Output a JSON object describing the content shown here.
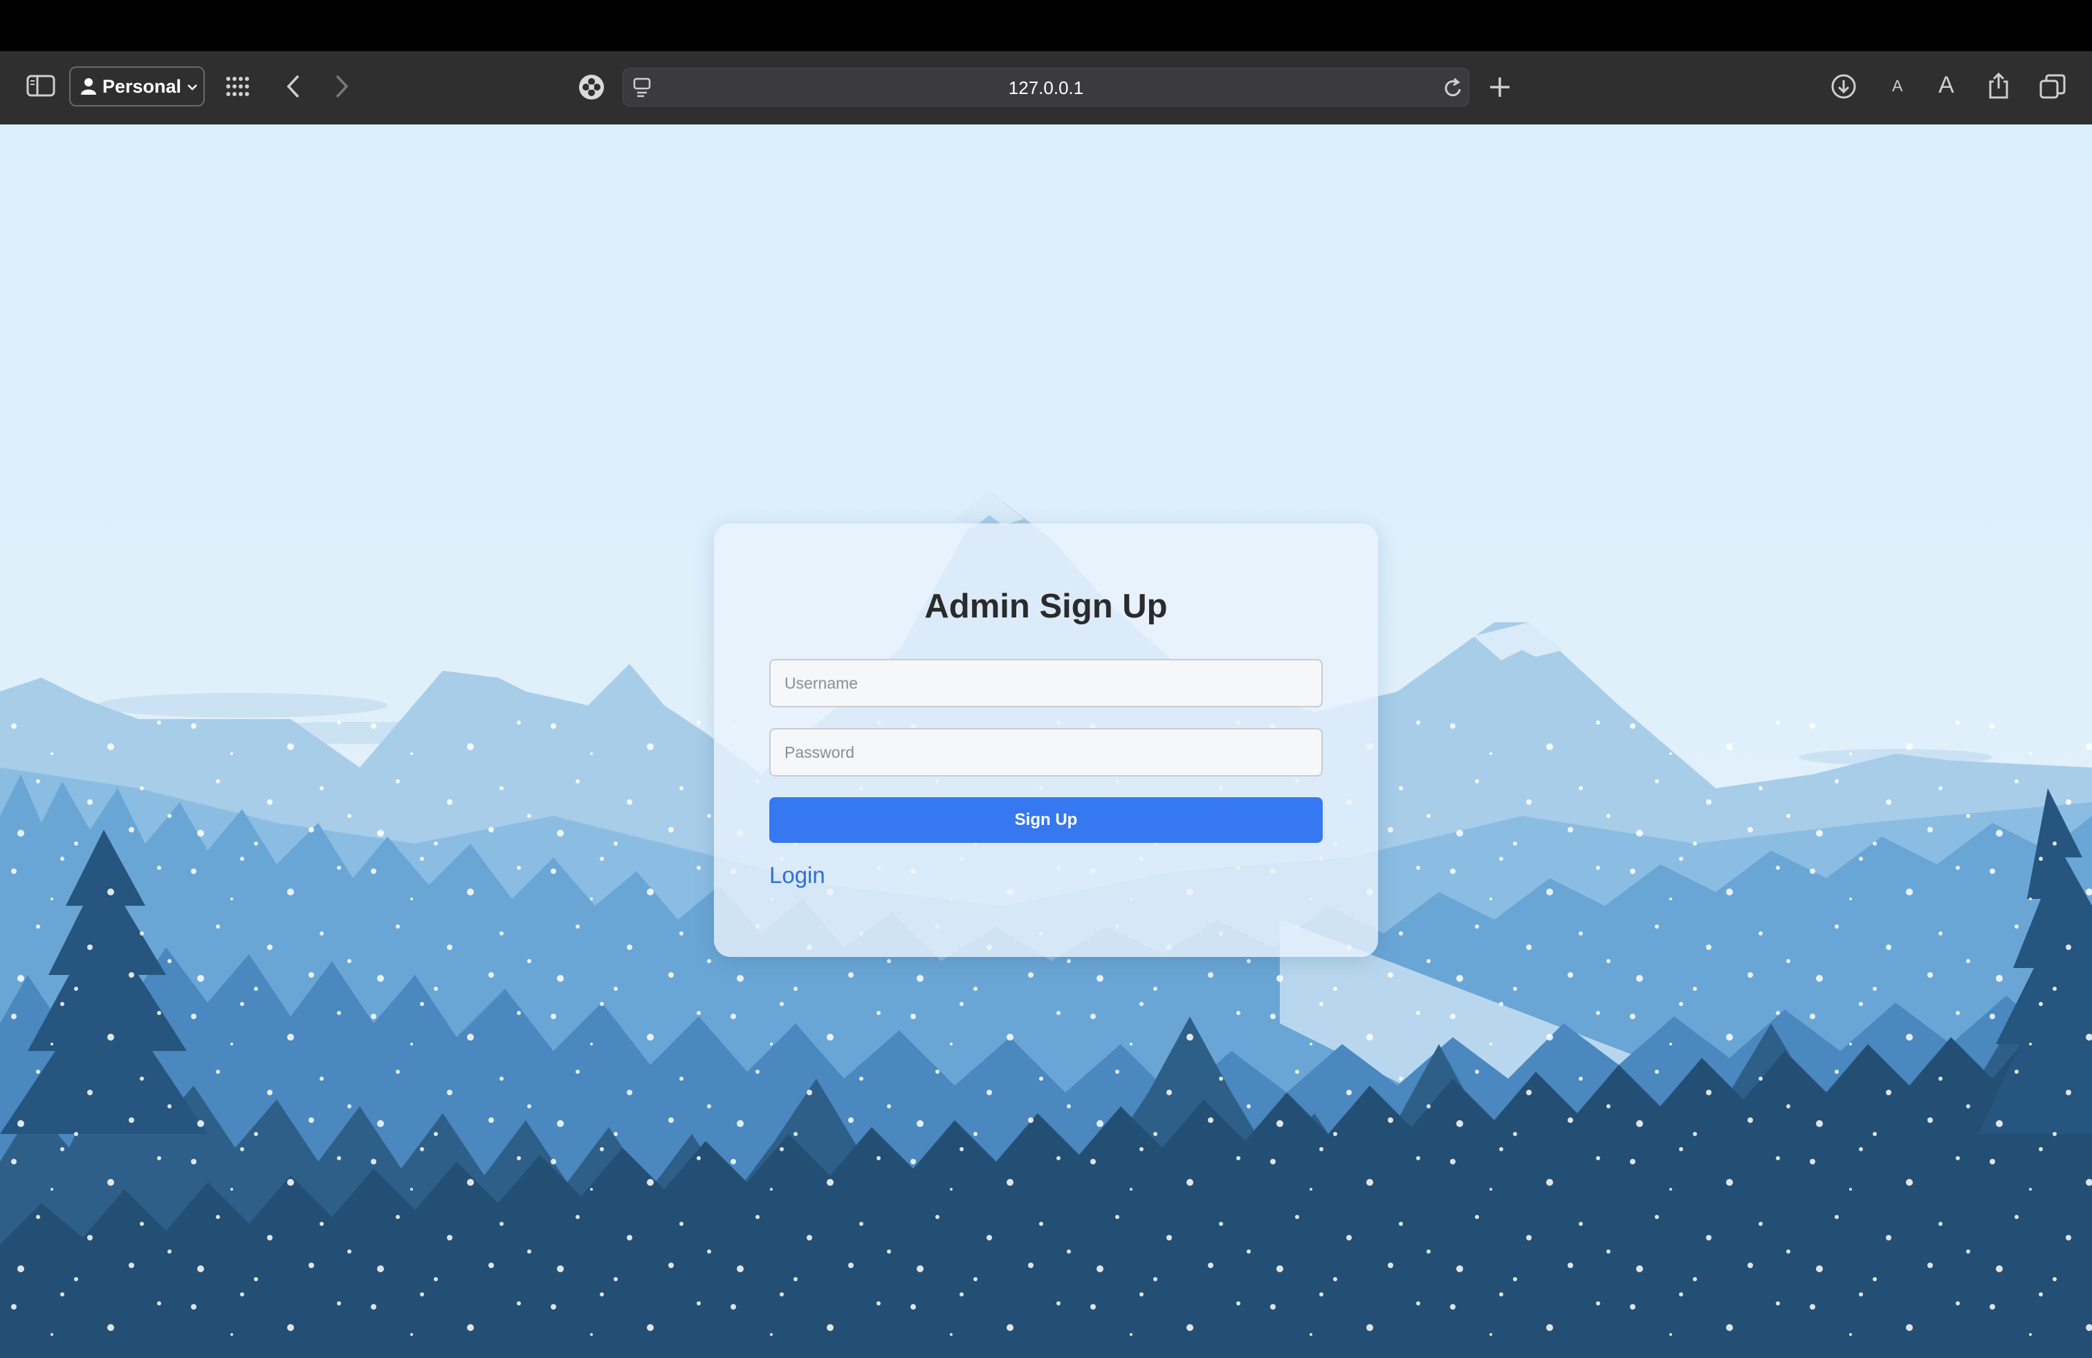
{
  "browser": {
    "profile_label": "Personal",
    "url": "127.0.0.1",
    "text_size_small": "A",
    "text_size_large": "A"
  },
  "form": {
    "title": "Admin Sign Up",
    "username_placeholder": "Username",
    "password_placeholder": "Password",
    "submit_label": "Sign Up",
    "login_link": "Login"
  },
  "colors": {
    "accent": "#3678f0",
    "link": "#2f6fd8",
    "toolbar": "#2f2f30"
  },
  "icons": [
    "sidebar-icon",
    "person-icon",
    "chevron-down-icon",
    "grid-icon",
    "back-icon",
    "forward-icon",
    "extension-icon",
    "page-menu-icon",
    "reload-icon",
    "new-tab-icon",
    "download-icon",
    "share-icon",
    "tabs-icon"
  ]
}
